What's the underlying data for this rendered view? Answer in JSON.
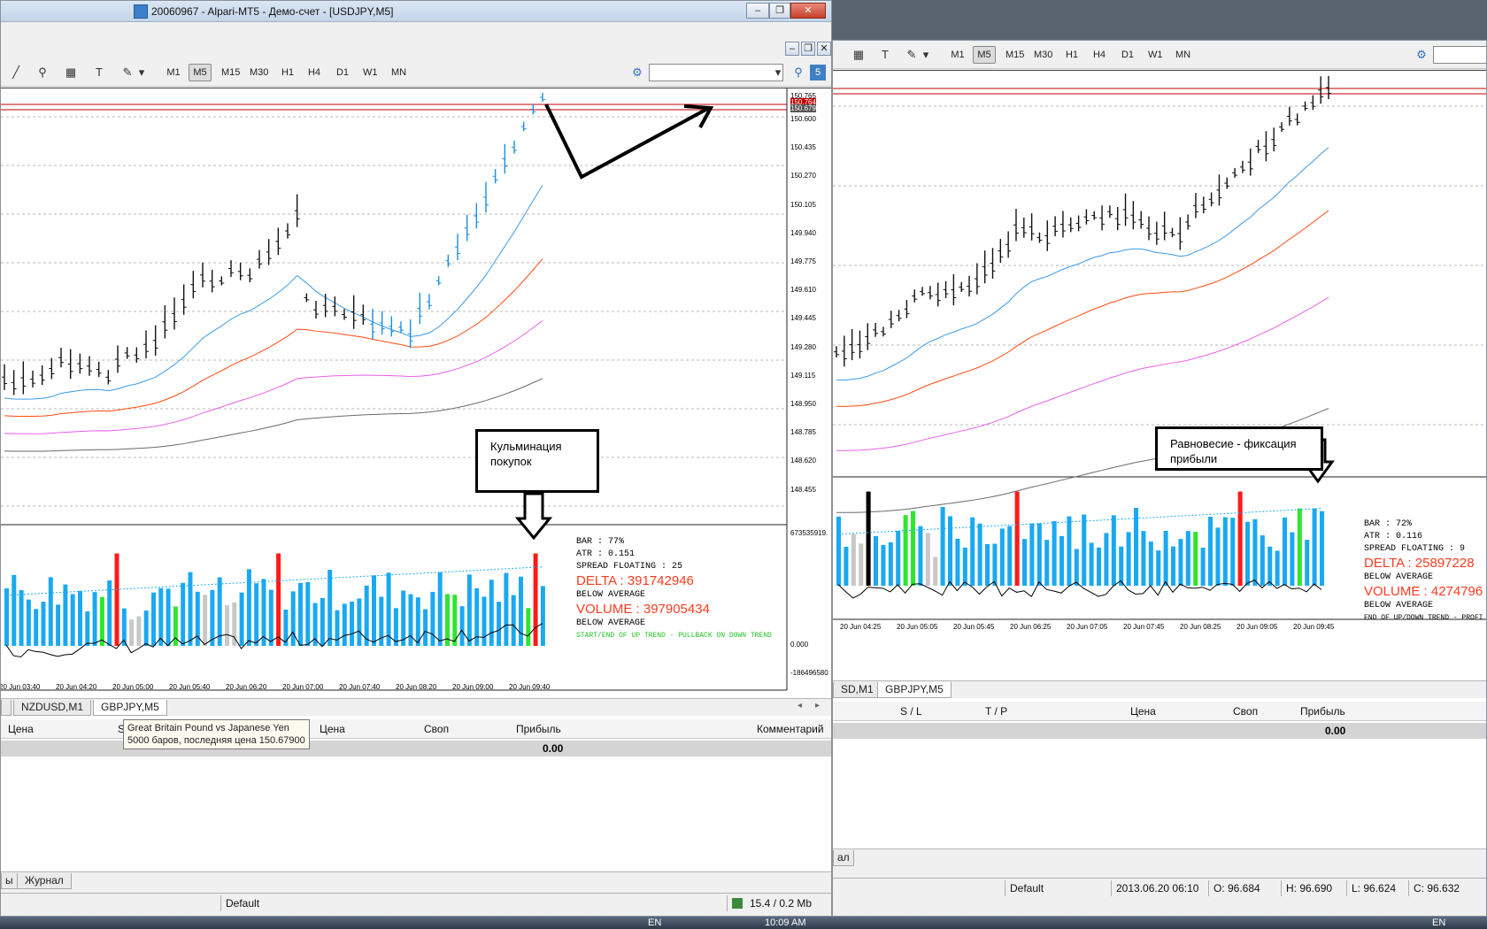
{
  "colors": {
    "bar_blue": "#1aa9f0",
    "bar_red": "#ff1a1a",
    "bar_green": "#2ee62e",
    "bar_grey": "#c8c8c8",
    "ema_blue": "#3a9be8",
    "ema_red": "#ff4a10",
    "ema_magenta": "#e860e8",
    "ema_grey": "#6a6a6a",
    "price_line": "#c00000",
    "delta_text": "#ff3b1f"
  },
  "left": {
    "title": "20060967 - Alpari-MT5 - Демо-счет - [USDJPY,M5]",
    "timeframes": [
      "M1",
      "M5",
      "M15",
      "M30",
      "H1",
      "H4",
      "D1",
      "W1",
      "MN"
    ],
    "active_tf": "M5",
    "search_placeholder": "",
    "help_badge": "5",
    "price_labels": [
      "150.765",
      "150.764",
      "150.679",
      "150.600",
      "150.435",
      "150.270",
      "150.105",
      "149.940",
      "149.775",
      "149.610",
      "149.445",
      "149.280",
      "149.115",
      "148.950",
      "148.785",
      "148.620",
      "148.455"
    ],
    "ind_top_label": "673535919.",
    "ind_mid_label": "0.000",
    "ind_bottom_label": "-186496580",
    "time_labels": [
      "20 Jun 03:40",
      "20 Jun 04:20",
      "20 Jun 05:00",
      "20 Jun 05:40",
      "20 Jun 06:20",
      "20 Jun 07:00",
      "20 Jun 07:40",
      "20 Jun 08:20",
      "20 Jun 09:00",
      "20 Jun 09:40"
    ],
    "annotation": "Кульминация покупок",
    "info": {
      "bar": "BAR : 77%",
      "atr": "ATR : 0.151",
      "spread": "SPREAD FLOATING : 25",
      "delta": "DELTA : 391742946",
      "delta_note": "BELOW AVERAGE",
      "volume": "VOLUME : 397905434",
      "volume_note": "BELOW AVERAGE",
      "trend": "START/END OF UP TREND - PULLBACK ON DOWN TREND"
    },
    "chart_tabs": [
      "NZDUSD,M1",
      "GBPJPY,M5"
    ],
    "active_chart_tab": "GBPJPY,M5",
    "table_headers": {
      "price": "Цена",
      "sl": "S",
      "price2": "Цена",
      "swap": "Своп",
      "profit": "Прибыль",
      "comment": "Комментарий"
    },
    "total_profit": "0.00",
    "tooltip_line1": "Great Britain Pound vs Japanese Yen",
    "tooltip_line2": "5000 баров, последняя цена 150.67900",
    "bottom_tabs": [
      "ы",
      "Журнал"
    ],
    "status_profile": "Default",
    "status_traffic": "15.4 / 0.2 Mb",
    "taskbar_lang": "EN",
    "taskbar_time": "10:09 AM"
  },
  "right": {
    "timeframes": [
      "M1",
      "M5",
      "M15",
      "M30",
      "H1",
      "H4",
      "D1",
      "W1",
      "MN"
    ],
    "active_tf": "M5",
    "time_labels": [
      "20 Jun 04:25",
      "20 Jun 05:05",
      "20 Jun 05:45",
      "20 Jun 06:25",
      "20 Jun 07:05",
      "20 Jun 07:45",
      "20 Jun 08:25",
      "20 Jun 09:05",
      "20 Jun 09:45"
    ],
    "annotation": "Равновесие - фиксация прибыли",
    "info": {
      "bar": "BAR : 72%",
      "atr": "ATR : 0.116",
      "spread": "SPREAD FLOATING : 9",
      "delta": "DELTA : 25897228",
      "delta_note": "BELOW AVERAGE",
      "volume": "VOLUME : 4274796",
      "volume_note": "BELOW AVERAGE",
      "trend": "END OF UP/DOWN TREND - PROFI"
    },
    "chart_tabs": [
      "SD,M1",
      "GBPJPY,M5"
    ],
    "active_chart_tab": "GBPJPY,M5",
    "table_headers": {
      "sl": "S / L",
      "tp": "T / P",
      "price": "Цена",
      "swap": "Своп",
      "profit": "Прибыль"
    },
    "total_profit": "0.00",
    "bottom_tab": "ал",
    "status_profile": "Default",
    "status_time": "2013.06.20 06:10",
    "status_open": "O: 96.684",
    "status_high": "H: 96.690",
    "status_low": "L: 96.624",
    "status_close": "C: 96.632",
    "taskbar_lang": "EN"
  }
}
